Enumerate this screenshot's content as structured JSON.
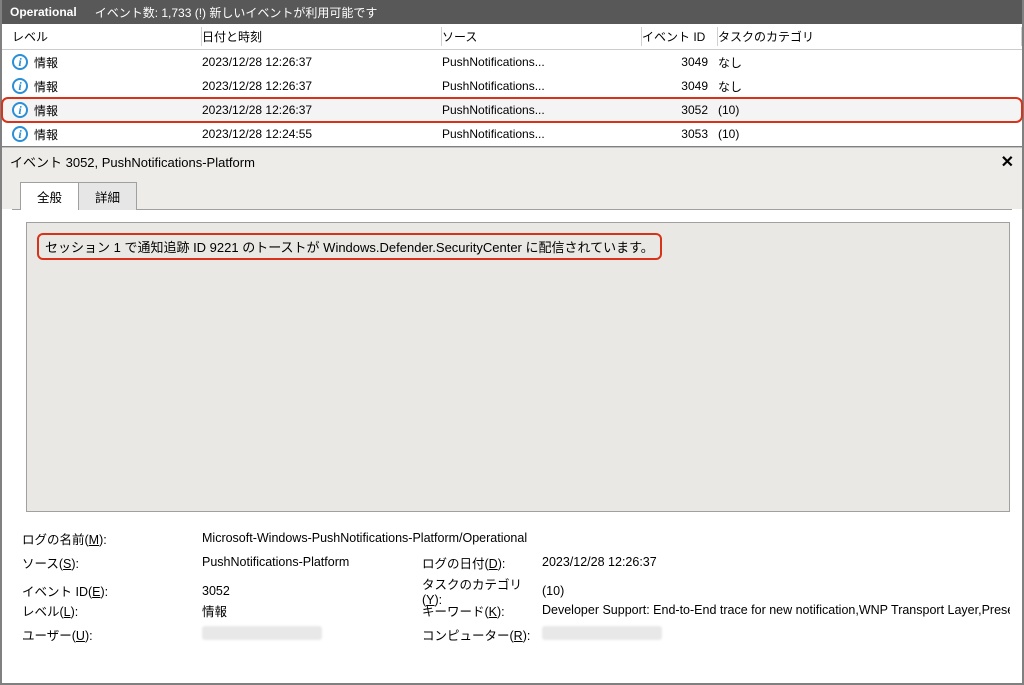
{
  "titlebar": {
    "name": "Operational",
    "events": "イベント数: 1,733 (!) 新しいイベントが利用可能です"
  },
  "columns": {
    "level": "レベル",
    "datetime": "日付と時刻",
    "source": "ソース",
    "eventid": "イベント ID",
    "taskcat": "タスクのカテゴリ"
  },
  "rows": [
    {
      "level": "情報",
      "dt": "2023/12/28 12:26:37",
      "src": "PushNotifications...",
      "eid": "3049",
      "cat": "なし",
      "sel": false
    },
    {
      "level": "情報",
      "dt": "2023/12/28 12:26:37",
      "src": "PushNotifications...",
      "eid": "3049",
      "cat": "なし",
      "sel": false
    },
    {
      "level": "情報",
      "dt": "2023/12/28 12:26:37",
      "src": "PushNotifications...",
      "eid": "3052",
      "cat": "(10)",
      "sel": true
    },
    {
      "level": "情報",
      "dt": "2023/12/28 12:24:55",
      "src": "PushNotifications...",
      "eid": "3053",
      "cat": "(10)",
      "sel": false
    }
  ],
  "detail": {
    "title": "イベント 3052, PushNotifications-Platform",
    "close": "✕",
    "tabs": {
      "general": "全般",
      "detail": "詳細"
    },
    "message": "セッション 1 で通知追跡 ID 9221 のトーストが Windows.Defender.SecurityCenter に配信されています。",
    "labels": {
      "logname": "ログの名前(M):",
      "source": "ソース(S):",
      "eventid": "イベント ID(E):",
      "level": "レベル(L):",
      "user": "ユーザー(U):",
      "logdate": "ログの日付(D):",
      "taskcat": "タスクのカテゴリ(Y):",
      "keywords": "キーワード(K):",
      "computer": "コンピューター(R):"
    },
    "values": {
      "logname": "Microsoft-Windows-PushNotifications-Platform/Operational",
      "source": "PushNotifications-Platform",
      "eventid": "3052",
      "level": "情報",
      "logdate": "2023/12/28 12:26:37",
      "taskcat": "(10)",
      "keywords": "Developer Support: End-to-End trace for new notification,WNP Transport Layer,Prese"
    }
  }
}
